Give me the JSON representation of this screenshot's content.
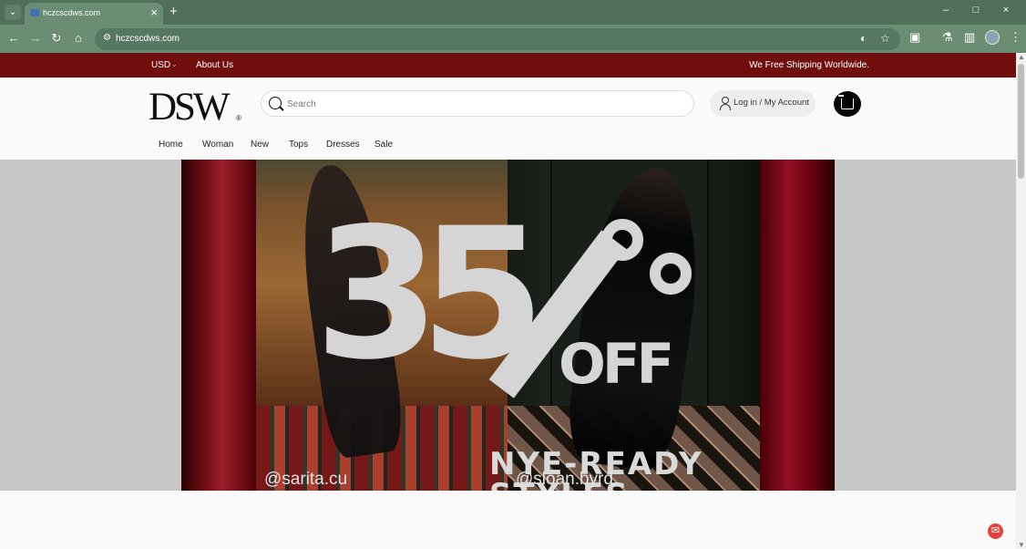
{
  "browser": {
    "tab_title": "hczcscdws.com",
    "url": "hczcscdws.com",
    "new_tab_symbol": "+",
    "close_symbol": "×",
    "window_controls": [
      "–",
      "□",
      "×"
    ],
    "icons": [
      "tab-menu-icon",
      "favicon",
      "back-icon",
      "forward-icon",
      "reload-icon",
      "home-icon",
      "site-info-icon",
      "visibility-off-icon",
      "bookmark-star-icon",
      "extensions-icon",
      "labs-icon",
      "sidebar-icon",
      "profile-avatar",
      "more-menu-icon"
    ]
  },
  "site": {
    "banner": {
      "currency": "USD",
      "about_label": "About Us",
      "shipping_message": "We Free Shipping Worldwide."
    },
    "brand": {
      "logo_text": "DSW",
      "logo_mark": "®"
    },
    "search": {
      "placeholder": "Search",
      "value": ""
    },
    "account": {
      "label": "Log in / My Account"
    },
    "navigation": [
      "Home",
      "Woman",
      "New",
      "Tops",
      "Dresses",
      "Sale"
    ],
    "hero": {
      "discount": "35",
      "percent": "%",
      "off": "OFF",
      "headline": "NYE-READY STYLES",
      "credits": [
        "@sarita.cu",
        "@sloan.byrd"
      ]
    }
  },
  "colors": {
    "browser_green": "#4f6f59",
    "banner_red": "#700d0d",
    "hero_gray": "#c8c8c8",
    "cart_black": "#050505"
  }
}
